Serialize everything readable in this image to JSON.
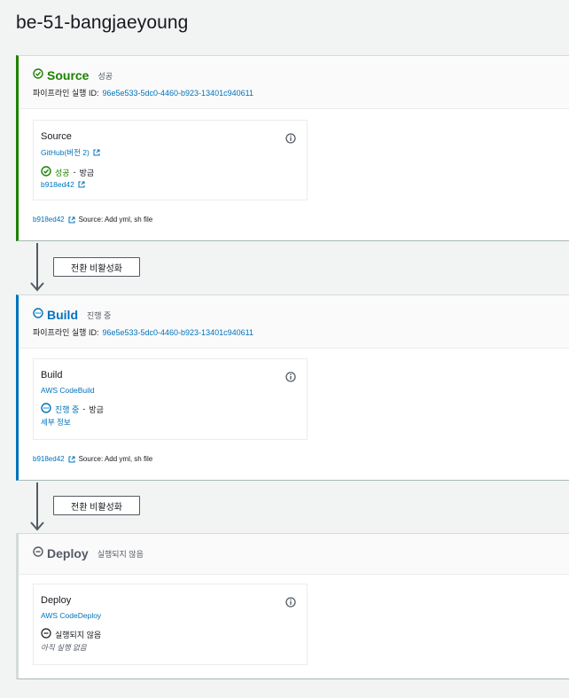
{
  "pipeline": {
    "name": "be-51-bangjaeyoung"
  },
  "labels": {
    "execution_id_label": "파이프라인 실행 ID:"
  },
  "stages": {
    "source": {
      "name": "Source",
      "status": "성공",
      "execution_id": "96e5e533-5dc0-4460-b923-13401c940611",
      "action": {
        "name": "Source",
        "provider": "GitHub(버전 2)",
        "status": "성공",
        "status_time": "방금",
        "detail": "b918ed42"
      },
      "commit": {
        "id": "b918ed42",
        "message": "Source: Add yml, sh file"
      }
    },
    "build": {
      "name": "Build",
      "status": "진행 중",
      "execution_id": "96e5e533-5dc0-4460-b923-13401c940611",
      "action": {
        "name": "Build",
        "provider": "AWS CodeBuild",
        "status": "진행 중",
        "status_time": "방금",
        "detail": "세부 정보"
      },
      "commit": {
        "id": "b918ed42",
        "message": "Source: Add yml, sh file"
      }
    },
    "deploy": {
      "name": "Deploy",
      "status": "실행되지 않음",
      "action": {
        "name": "Deploy",
        "provider": "AWS CodeDeploy",
        "status": "실행되지 않음",
        "detail": "아직 실행 없음"
      }
    }
  },
  "transitions": [
    {
      "label": "전환 비활성화"
    },
    {
      "label": "전환 비활성화"
    }
  ],
  "status_separator": "-",
  "colors": {
    "success": "#1d8102",
    "in_progress": "#0073bb",
    "not_run": "#545b64",
    "link": "#0073bb"
  },
  "icons": {
    "success": "check-circle-icon",
    "in_progress": "in-progress-icon",
    "not_run": "minus-circle-icon",
    "info": "info-icon",
    "external": "external-link-icon",
    "arrow": "arrow-down-icon"
  }
}
